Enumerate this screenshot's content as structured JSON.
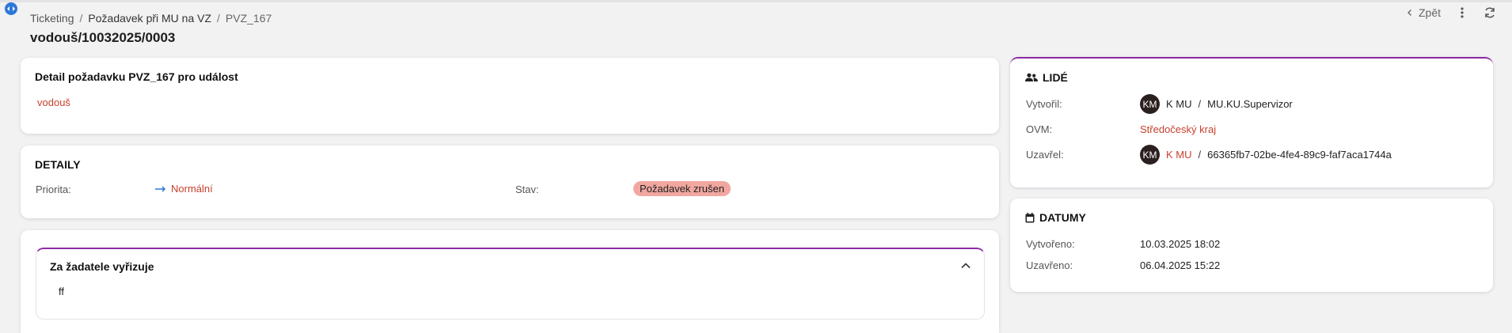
{
  "breadcrumb": {
    "items": [
      "Ticketing",
      "Požadavek při MU na VZ",
      "PVZ_167"
    ]
  },
  "page": {
    "title": "vodouš/10032025/0003"
  },
  "actions": {
    "back_label": "Zpět"
  },
  "detail_card": {
    "title": "Detail požadavku PVZ_167 pro událost",
    "event_link": "vodouš"
  },
  "detaily": {
    "title": "DETAILY",
    "priority_label": "Priorita:",
    "priority_value": "Normální",
    "status_label": "Stav:",
    "status_value": "Požadavek zrušen"
  },
  "handler": {
    "title": "Za žadatele vyřizuje",
    "content": "ff"
  },
  "people": {
    "title": "LIDÉ",
    "created_by_label": "Vytvořil:",
    "created_by_avatar": "KM",
    "created_by_name": "K MU",
    "created_by_role": "MU.KU.Supervizor",
    "ovm_label": "OVM:",
    "ovm_value": "Středočeský kraj",
    "closed_by_label": "Uzavřel:",
    "closed_by_avatar": "KM",
    "closed_by_name": "K MU",
    "closed_by_id": "66365fb7-02be-4fe4-89c9-faf7aca1744a"
  },
  "dates": {
    "title": "DATUMY",
    "created_label": "Vytvořeno:",
    "created_value": "10.03.2025 18:02",
    "closed_label": "Uzavřeno:",
    "closed_value": "06.04.2025 15:22"
  },
  "colors": {
    "accent_purple": "#8e2aa6",
    "link_red": "#c7412e",
    "badge_bg": "#f1a7a0",
    "priority_arrow": "#2e78d8"
  }
}
